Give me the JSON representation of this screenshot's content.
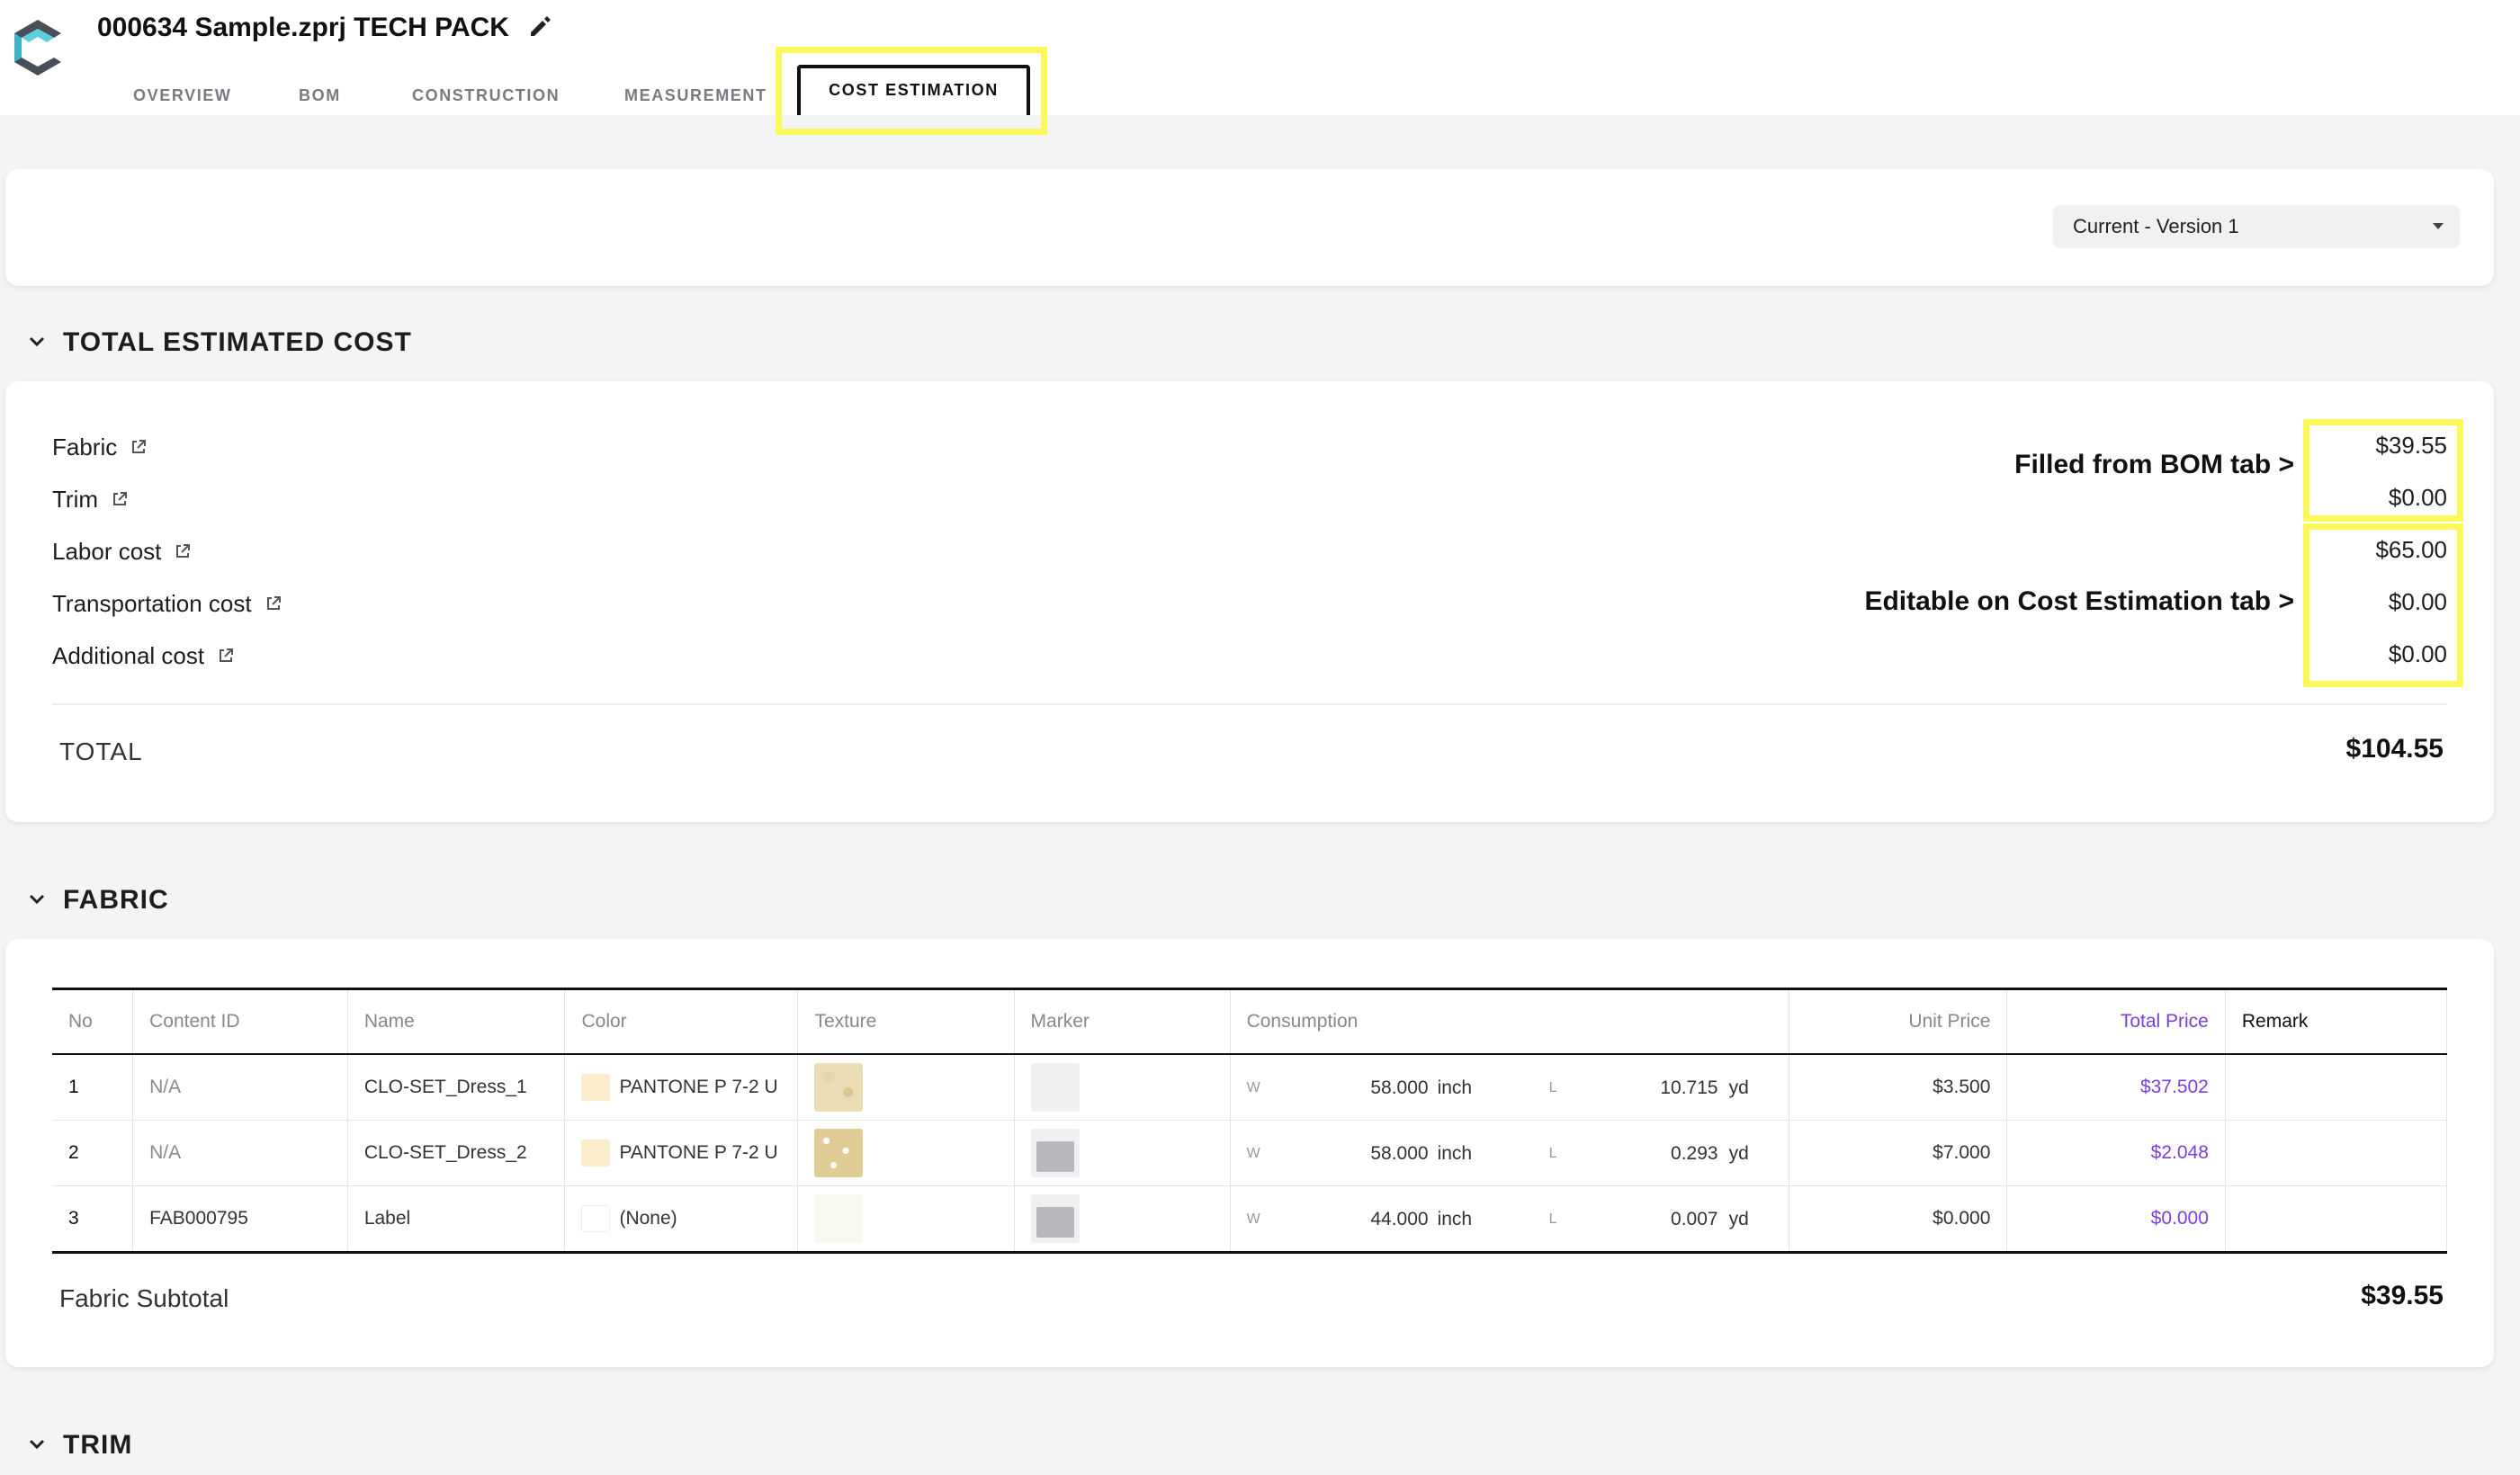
{
  "header": {
    "title": "000634 Sample.zprj TECH PACK",
    "tabs": [
      "OVERVIEW",
      "BOM",
      "CONSTRUCTION",
      "MEASUREMENT",
      "COST ESTIMATION"
    ],
    "active_tab": "COST ESTIMATION"
  },
  "version_select": {
    "value": "Current - Version 1"
  },
  "total_estimated_cost": {
    "title": "TOTAL ESTIMATED COST",
    "items": [
      {
        "label": "Fabric",
        "value": "$39.55"
      },
      {
        "label": "Trim",
        "value": "$0.00"
      },
      {
        "label": "Labor cost",
        "value": "$65.00"
      },
      {
        "label": "Transportation cost",
        "value": "$0.00"
      },
      {
        "label": "Additional cost",
        "value": "$0.00"
      }
    ],
    "annotation_bom": "Filled from BOM tab >",
    "annotation_editable": "Editable on Cost Estimation tab >",
    "total_label": "TOTAL",
    "total_value": "$104.55"
  },
  "fabric": {
    "title": "FABRIC",
    "columns": {
      "no": "No",
      "content_id": "Content ID",
      "name": "Name",
      "color": "Color",
      "texture": "Texture",
      "marker": "Marker",
      "consumption": "Consumption",
      "unit_price": "Unit Price",
      "total_price": "Total Price",
      "remark": "Remark"
    },
    "rows": [
      {
        "no": "1",
        "content_id": "N/A",
        "name": "CLO-SET_Dress_1",
        "color": "PANTONE P 7-2 U",
        "w_label": "W",
        "w_value": "58.000",
        "w_unit": "inch",
        "l_label": "L",
        "l_value": "10.715",
        "l_unit": "yd",
        "unit_price": "$3.500",
        "total_price": "$37.502"
      },
      {
        "no": "2",
        "content_id": "N/A",
        "name": "CLO-SET_Dress_2",
        "color": "PANTONE P 7-2 U",
        "w_label": "W",
        "w_value": "58.000",
        "w_unit": "inch",
        "l_label": "L",
        "l_value": "0.293",
        "l_unit": "yd",
        "unit_price": "$7.000",
        "total_price": "$2.048"
      },
      {
        "no": "3",
        "content_id": "FAB000795",
        "name": "Label",
        "color": "(None)",
        "w_label": "W",
        "w_value": "44.000",
        "w_unit": "inch",
        "l_label": "L",
        "l_value": "0.007",
        "l_unit": "yd",
        "unit_price": "$0.000",
        "total_price": "$0.000"
      }
    ],
    "subtotal_label": "Fabric Subtotal",
    "subtotal_value": "$39.55"
  },
  "trim": {
    "title": "TRIM"
  },
  "colors": {
    "highlight": "#fbf85a",
    "accent_purple": "#7c3fd9",
    "pantone_swatch": "#fbeccb"
  }
}
